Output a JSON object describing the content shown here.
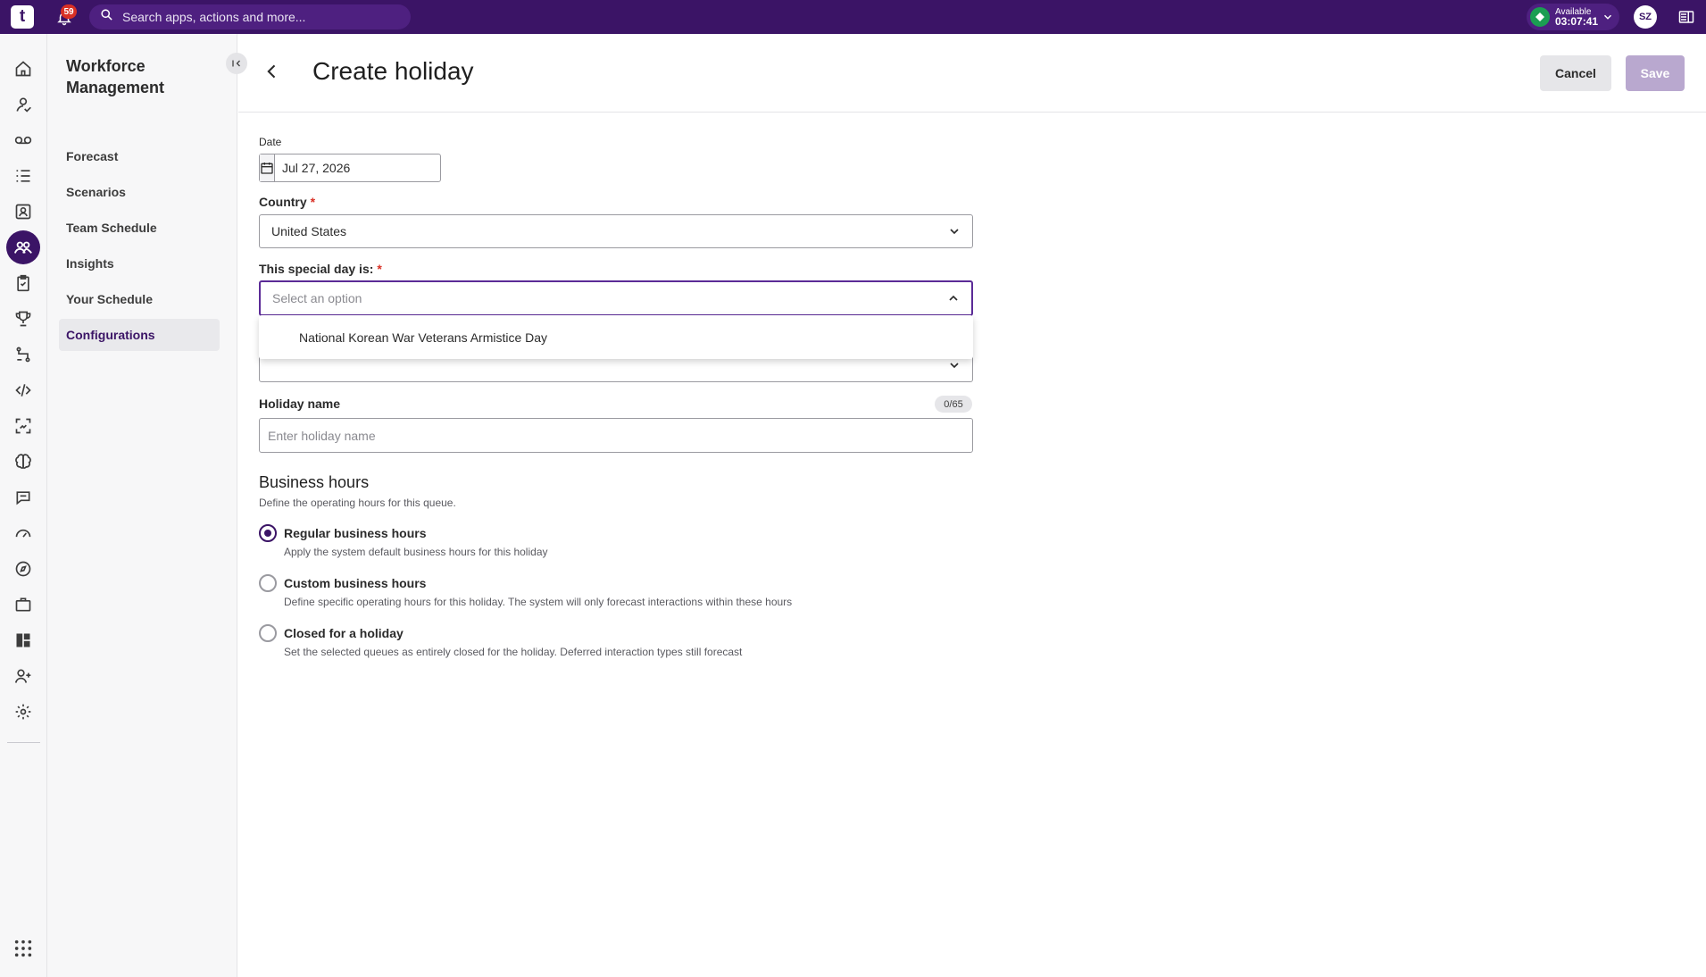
{
  "topbar": {
    "logo_text": "t",
    "notification_count": "59",
    "search_placeholder": "Search apps, actions and more...",
    "status_label": "Available",
    "status_timer": "03:07:41",
    "avatar_initials": "SZ",
    "brand_color": "#3b1466"
  },
  "rail": {
    "icons": [
      "home-icon",
      "agent-icon",
      "voicemail-icon",
      "list-icon",
      "contacts-icon",
      "workforce-icon",
      "clipboard-icon",
      "trophy-icon",
      "flow-icon",
      "code-icon",
      "scan-icon",
      "brain-icon",
      "chat-icon",
      "speedometer-icon",
      "compass-icon",
      "briefcase-icon",
      "dashboard-icon",
      "user-plus-icon",
      "settings-icon",
      "apps-grid-icon"
    ],
    "active": "workforce-icon"
  },
  "subnav": {
    "title": "Workforce Management",
    "items": [
      {
        "label": "Forecast"
      },
      {
        "label": "Scenarios"
      },
      {
        "label": "Team Schedule"
      },
      {
        "label": "Insights"
      },
      {
        "label": "Your Schedule"
      },
      {
        "label": "Configurations",
        "active": true
      }
    ]
  },
  "page": {
    "title": "Create holiday",
    "cancel_label": "Cancel",
    "save_label": "Save"
  },
  "form": {
    "date_label": "Date",
    "date_value": "Jul 27, 2026",
    "country_label": "Country",
    "country_value": "United States",
    "special_day_label": "This special day is:",
    "special_day_placeholder": "Select an option",
    "special_day_options": [
      "National Korean War Veterans Armistice Day"
    ],
    "required_mark": "*",
    "holiday_name_label": "Holiday name",
    "holiday_name_placeholder": "Enter holiday name",
    "holiday_name_counter": "0/65",
    "business_hours": {
      "title": "Business hours",
      "description": "Define the operating hours for this queue.",
      "options": [
        {
          "label": "Regular business hours",
          "description": "Apply the system default business hours for this holiday",
          "checked": true
        },
        {
          "label": "Custom business hours",
          "description": "Define specific operating hours for this holiday. The system will only forecast interactions within these hours",
          "checked": false
        },
        {
          "label": "Closed for a holiday",
          "description": "Set the selected queues as entirely closed for the holiday. Deferred interaction types still forecast",
          "checked": false
        }
      ]
    }
  }
}
